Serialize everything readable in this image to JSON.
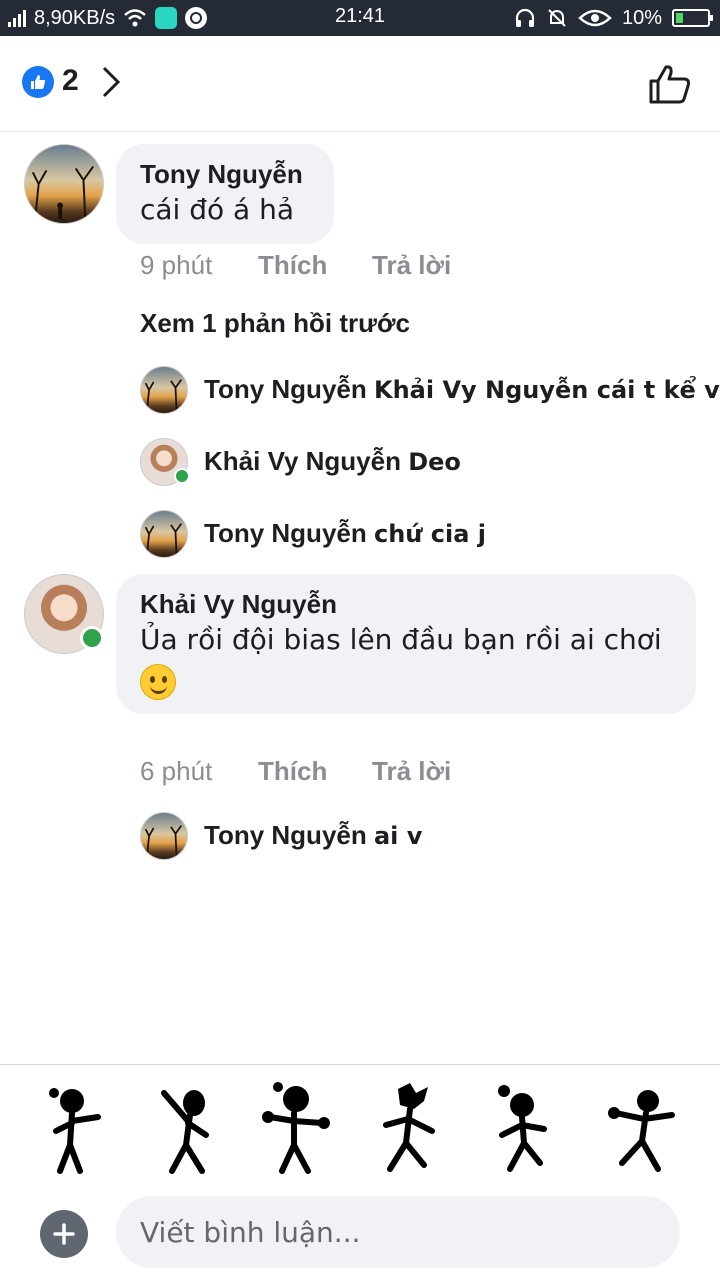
{
  "status_bar": {
    "speed": "8,90KB/s",
    "time": "21:41",
    "battery": "10%"
  },
  "header": {
    "like_count": "2"
  },
  "comments": [
    {
      "author": "Tony Nguyễn",
      "text": "cái đó á hả",
      "time": "9 phút",
      "like_label": "Thích",
      "reply_label": "Trả lời",
      "view_previous": "Xem 1 phản hồi trước",
      "replies": [
        {
          "author": "Tony Nguyễn",
          "text": "Khải Vy Nguyễn cái t kể vs..."
        },
        {
          "author": "Khải Vy Nguyễn",
          "text": "Deo"
        },
        {
          "author": "Tony Nguyễn",
          "text": "chứ cia j"
        }
      ]
    },
    {
      "author": "Khải Vy Nguyễn",
      "text": "Ủa rồi đội bias lên đầu bạn rồi ai chơi",
      "time": "6 phút",
      "like_label": "Thích",
      "reply_label": "Trả lời",
      "replies": [
        {
          "author": "Tony Nguyễn",
          "text": "ai v"
        }
      ]
    }
  ],
  "composer": {
    "placeholder": "Viết bình luận..."
  },
  "colors": {
    "accent": "#1877f2",
    "online": "#31a24c",
    "bubble": "#f0f2f5"
  },
  "icons": [
    "like-badge-icon",
    "chevron-right-icon",
    "thumbs-up-icon",
    "plus-icon",
    "smile-emoji-icon"
  ]
}
